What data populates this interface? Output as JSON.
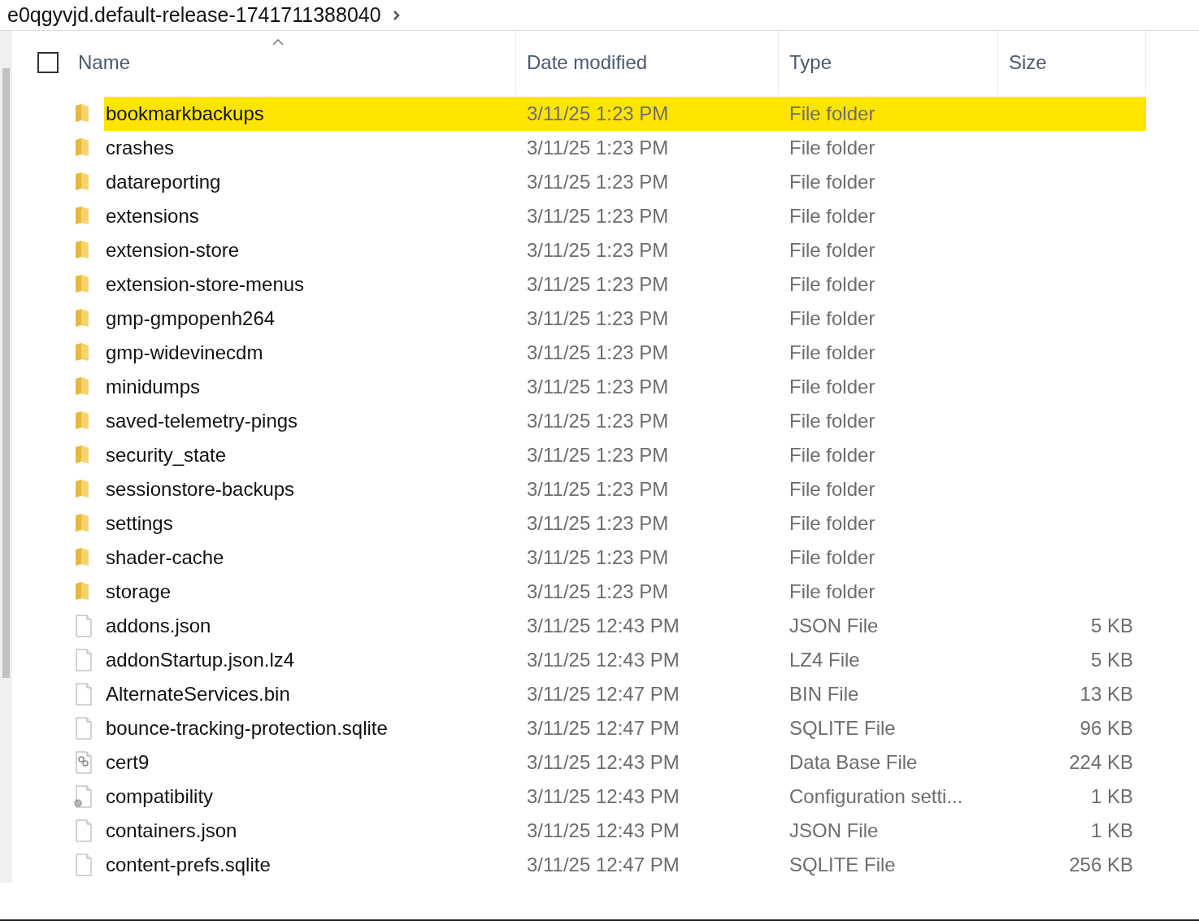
{
  "breadcrumb": {
    "folder": "e0qgyvjd.default-release-1741711388040"
  },
  "columns": [
    {
      "label": "Name",
      "sorted": true
    },
    {
      "label": "Date modified",
      "sorted": false
    },
    {
      "label": "Type",
      "sorted": false
    },
    {
      "label": "Size",
      "sorted": false
    }
  ],
  "select_all": {
    "checked": false
  },
  "rows": [
    {
      "kind": "folder",
      "name": "bookmarkbackups",
      "date": "3/11/25 1:23 PM",
      "type": "File folder",
      "selected": true
    },
    {
      "kind": "folder",
      "name": "crashes",
      "date": "3/11/25 1:23 PM",
      "type": "File folder",
      "selected": false
    },
    {
      "kind": "folder",
      "name": "datareporting",
      "date": "3/11/25 1:23 PM",
      "type": "File folder",
      "selected": false
    },
    {
      "kind": "folder",
      "name": "extensions",
      "date": "3/11/25 1:23 PM",
      "type": "File folder",
      "selected": false
    },
    {
      "kind": "folder",
      "name": "extension-store",
      "date": "3/11/25 1:23 PM",
      "type": "File folder",
      "selected": false
    },
    {
      "kind": "folder",
      "name": "extension-store-menus",
      "date": "3/11/25 1:23 PM",
      "type": "File folder",
      "selected": false
    },
    {
      "kind": "folder",
      "name": "gmp-gmpopenh264",
      "date": "3/11/25 1:23 PM",
      "type": "File folder",
      "selected": false
    },
    {
      "kind": "folder",
      "name": "gmp-widevinecdm",
      "date": "3/11/25 1:23 PM",
      "type": "File folder",
      "selected": false
    },
    {
      "kind": "folder",
      "name": "minidumps",
      "date": "3/11/25 1:23 PM",
      "type": "File folder",
      "selected": false
    },
    {
      "kind": "folder",
      "name": "saved-telemetry-pings",
      "date": "3/11/25 1:23 PM",
      "type": "File folder",
      "selected": false
    },
    {
      "kind": "folder",
      "name": "security_state",
      "date": "3/11/25 1:23 PM",
      "type": "File folder",
      "selected": false
    },
    {
      "kind": "folder",
      "name": "sessionstore-backups",
      "date": "3/11/25 1:23 PM",
      "type": "File folder",
      "selected": false
    },
    {
      "kind": "folder",
      "name": "settings",
      "date": "3/11/25 1:23 PM",
      "type": "File folder",
      "selected": false
    },
    {
      "kind": "folder",
      "name": "shader-cache",
      "date": "3/11/25 1:23 PM",
      "type": "File folder",
      "selected": false
    },
    {
      "kind": "folder",
      "name": "storage",
      "date": "3/11/25 1:23 PM",
      "type": "File folder",
      "selected": false
    },
    {
      "kind": "file",
      "name": "addons.json",
      "date": "3/11/25 12:43 PM",
      "type": "JSON File",
      "size": "5 KB",
      "selected": false
    },
    {
      "kind": "file",
      "name": "addonStartup.json.lz4",
      "date": "3/11/25 12:43 PM",
      "type": "LZ4 File",
      "size": "5 KB",
      "selected": false
    },
    {
      "kind": "file",
      "name": "AlternateServices.bin",
      "date": "3/11/25 12:47 PM",
      "type": "BIN File",
      "size": "13 KB",
      "selected": false
    },
    {
      "kind": "file",
      "name": "bounce-tracking-protection.sqlite",
      "date": "3/11/25 12:47 PM",
      "type": "SQLITE File",
      "size": "96 KB",
      "selected": false
    },
    {
      "kind": "database",
      "name": "cert9",
      "date": "3/11/25 12:43 PM",
      "type": "Data Base File",
      "size": "224 KB",
      "selected": false
    },
    {
      "kind": "config",
      "name": "compatibility",
      "date": "3/11/25 12:43 PM",
      "type": "Configuration setti...",
      "size": "1 KB",
      "selected": false
    },
    {
      "kind": "file",
      "name": "containers.json",
      "date": "3/11/25 12:43 PM",
      "type": "JSON File",
      "size": "1 KB",
      "selected": false
    },
    {
      "kind": "file",
      "name": "content-prefs.sqlite",
      "date": "3/11/25 12:47 PM",
      "type": "SQLITE File",
      "size": "256 KB",
      "selected": false
    }
  ]
}
